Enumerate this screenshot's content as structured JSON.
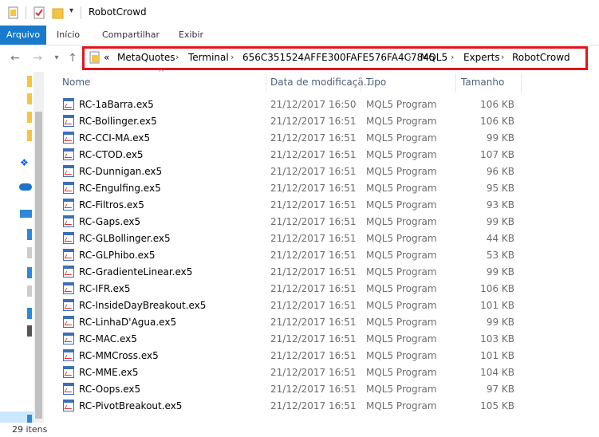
{
  "window": {
    "title": "RobotCrowd"
  },
  "ribbon": {
    "tabs": [
      "Arquivo",
      "Início",
      "Compartilhar",
      "Exibir"
    ]
  },
  "address": {
    "overflow": "«",
    "crumbs": [
      "MetaQuotes",
      "Terminal",
      "656C351524AFFE300FAFE576FA4C7845",
      "MQL5",
      "Experts",
      "RobotCrowd"
    ]
  },
  "columns": {
    "name": "Nome",
    "date": "Data de modificaçã...",
    "type": "Tipo",
    "size": "Tamanho"
  },
  "files": [
    {
      "name": "RC-1aBarra.ex5",
      "date": "21/12/2017 16:50",
      "type": "MQL5 Program",
      "size": "106 KB"
    },
    {
      "name": "RC-Bollinger.ex5",
      "date": "21/12/2017 16:51",
      "type": "MQL5 Program",
      "size": "106 KB"
    },
    {
      "name": "RC-CCI-MA.ex5",
      "date": "21/12/2017 16:51",
      "type": "MQL5 Program",
      "size": "99 KB"
    },
    {
      "name": "RC-CTOD.ex5",
      "date": "21/12/2017 16:51",
      "type": "MQL5 Program",
      "size": "107 KB"
    },
    {
      "name": "RC-Dunnigan.ex5",
      "date": "21/12/2017 16:51",
      "type": "MQL5 Program",
      "size": "96 KB"
    },
    {
      "name": "RC-Engulfing.ex5",
      "date": "21/12/2017 16:51",
      "type": "MQL5 Program",
      "size": "95 KB"
    },
    {
      "name": "RC-Filtros.ex5",
      "date": "21/12/2017 16:51",
      "type": "MQL5 Program",
      "size": "93 KB"
    },
    {
      "name": "RC-Gaps.ex5",
      "date": "21/12/2017 16:51",
      "type": "MQL5 Program",
      "size": "99 KB"
    },
    {
      "name": "RC-GLBollinger.ex5",
      "date": "21/12/2017 16:51",
      "type": "MQL5 Program",
      "size": "44 KB"
    },
    {
      "name": "RC-GLPhibo.ex5",
      "date": "21/12/2017 16:51",
      "type": "MQL5 Program",
      "size": "53 KB"
    },
    {
      "name": "RC-GradienteLinear.ex5",
      "date": "21/12/2017 16:51",
      "type": "MQL5 Program",
      "size": "99 KB"
    },
    {
      "name": "RC-IFR.ex5",
      "date": "21/12/2017 16:51",
      "type": "MQL5 Program",
      "size": "106 KB"
    },
    {
      "name": "RC-InsideDayBreakout.ex5",
      "date": "21/12/2017 16:51",
      "type": "MQL5 Program",
      "size": "101 KB"
    },
    {
      "name": "RC-LinhaD'Agua.ex5",
      "date": "21/12/2017 16:51",
      "type": "MQL5 Program",
      "size": "99 KB"
    },
    {
      "name": "RC-MAC.ex5",
      "date": "21/12/2017 16:51",
      "type": "MQL5 Program",
      "size": "103 KB"
    },
    {
      "name": "RC-MMCross.ex5",
      "date": "21/12/2017 16:51",
      "type": "MQL5 Program",
      "size": "101 KB"
    },
    {
      "name": "RC-MME.ex5",
      "date": "21/12/2017 16:51",
      "type": "MQL5 Program",
      "size": "104 KB"
    },
    {
      "name": "RC-Oops.ex5",
      "date": "21/12/2017 16:51",
      "type": "MQL5 Program",
      "size": "97 KB"
    },
    {
      "name": "RC-PivotBreakout.ex5",
      "date": "21/12/2017 16:51",
      "type": "MQL5 Program",
      "size": "105 KB"
    }
  ],
  "status": {
    "count": "29 itens"
  },
  "colors": {
    "accent": "#1979ca",
    "highlight_border": "#e5141b"
  }
}
